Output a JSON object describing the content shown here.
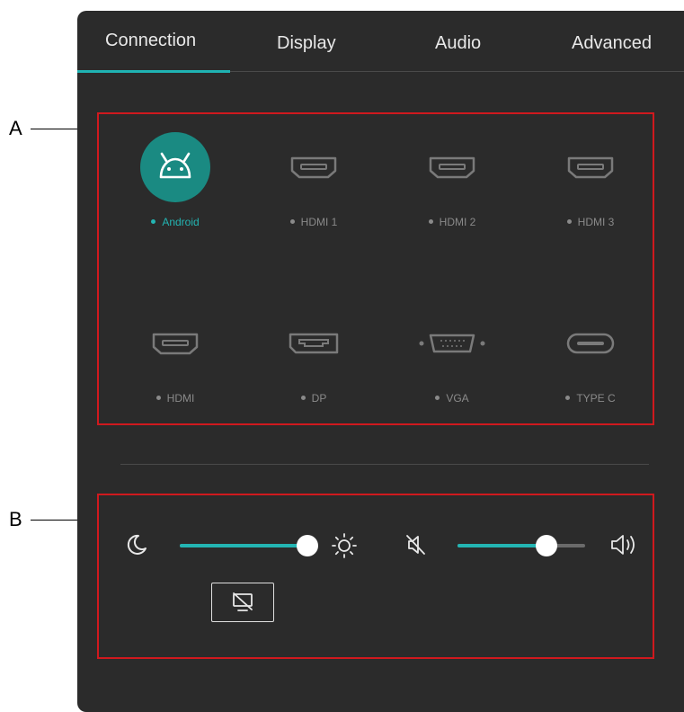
{
  "callouts": {
    "a": "A",
    "b": "B"
  },
  "tabs": [
    {
      "label": "Connection",
      "active": true
    },
    {
      "label": "Display"
    },
    {
      "label": "Audio"
    },
    {
      "label": "Advanced"
    }
  ],
  "sources": [
    {
      "label": "Android",
      "icon": "android-icon",
      "active": true
    },
    {
      "label": "HDMI 1",
      "icon": "hdmi-icon"
    },
    {
      "label": "HDMI 2",
      "icon": "hdmi-icon"
    },
    {
      "label": "HDMI 3",
      "icon": "hdmi-icon"
    },
    {
      "label": "HDMI",
      "icon": "hdmi-icon"
    },
    {
      "label": "DP",
      "icon": "displayport-icon"
    },
    {
      "label": "VGA",
      "icon": "vga-icon"
    },
    {
      "label": "TYPE C",
      "icon": "usb-c-icon"
    }
  ],
  "controls": {
    "brightness": {
      "level": 1.0,
      "min_icon": "moon-icon",
      "max_icon": "sun-icon"
    },
    "volume": {
      "level": 0.7,
      "min_icon": "mute-icon",
      "max_icon": "speaker-icon"
    },
    "screen_off_icon": "screen-off-icon"
  },
  "colors": {
    "accent": "#23b5b3",
    "android_bg": "#1a8a82",
    "highlight_box": "#d0191e",
    "panel_bg": "#2b2b2b"
  }
}
